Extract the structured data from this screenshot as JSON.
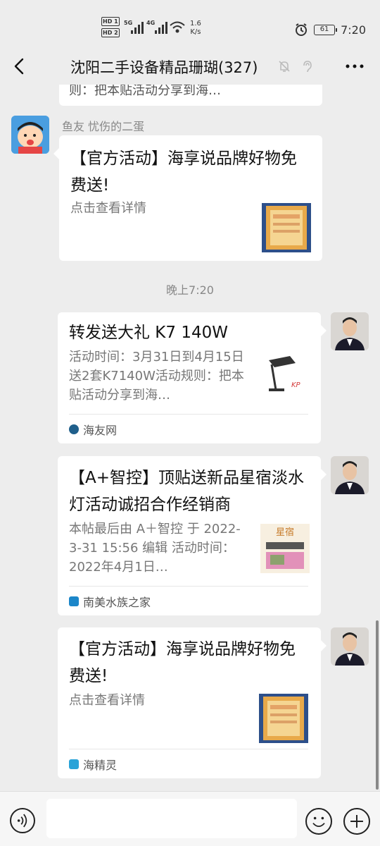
{
  "status_bar": {
    "hd1": "HD 1",
    "hd2": "HD 2",
    "net1": "5G",
    "net2": "4G",
    "speed_value": "1.6",
    "speed_unit": "K/s",
    "battery": "61",
    "time": "7:20"
  },
  "header": {
    "title": "沈阳二手设备精品珊瑚(327)"
  },
  "chat": {
    "prev_card_text": "则：把本贴活动分享到海…",
    "messages": [
      {
        "sender": "鱼友 忧伤的二蛋",
        "title": "【官方活动】海享说品牌好物免费送!",
        "desc": "点击查看详情",
        "thumb": "thumbnail-image"
      },
      {
        "title": "转发送大礼 K7 140W",
        "desc": "活动时间：3月31日到4月15日送2套K7140W活动规则：把本贴活动分享到海…",
        "source": "海友网",
        "source_color": "#1f5f8b"
      },
      {
        "title": "【A+智控】顶贴送新品星宿淡水灯活动诚招合作经销商",
        "desc": "本帖最后由 A＋智控 于 2022-3-31 15:56 编辑 活动时间：2022年4月1日…",
        "source": "南美水族之家",
        "source_color": "#1b86c9",
        "thumb_label": "星宿"
      },
      {
        "title": "【官方活动】海享说品牌好物免费送!",
        "desc": "点击查看详情",
        "source": "海精灵",
        "source_color": "#29a3d8"
      }
    ],
    "time_label": "晚上7:20"
  },
  "colors": {
    "background": "#ededed",
    "card": "#ffffff",
    "accent": "#111111"
  }
}
